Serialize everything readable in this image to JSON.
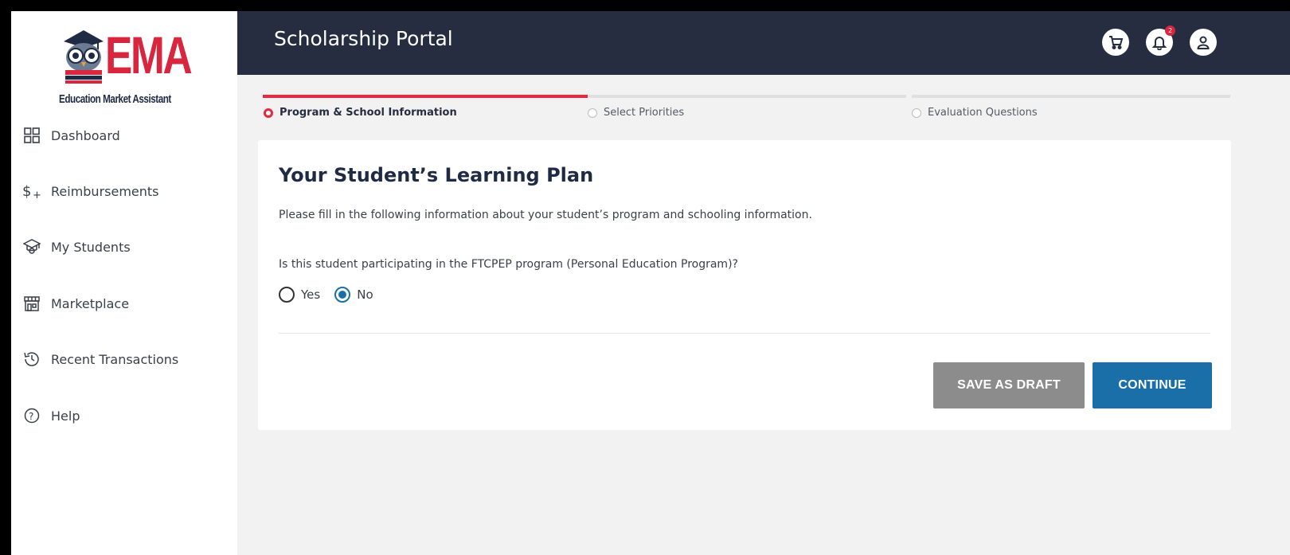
{
  "logo": {
    "brand": "EMA",
    "tagline": "Education Market Assistant",
    "brand_color": "#d7263d"
  },
  "sidebar": {
    "items": [
      {
        "label": "Dashboard",
        "icon": "dashboard-grid-icon"
      },
      {
        "label": "Reimbursements",
        "icon": "dollar-plus-icon"
      },
      {
        "label": "My Students",
        "icon": "graduation-cap-icon"
      },
      {
        "label": "Marketplace",
        "icon": "storefront-icon"
      },
      {
        "label": "Recent Transactions",
        "icon": "history-clock-icon"
      },
      {
        "label": "Help",
        "icon": "help-circle-icon"
      }
    ]
  },
  "header": {
    "title": "Scholarship Portal",
    "background": "#262d40",
    "icons": [
      {
        "name": "cart-icon"
      },
      {
        "name": "notification-bell-icon",
        "badge": "2"
      },
      {
        "name": "user-account-icon"
      }
    ]
  },
  "stepper": {
    "accent": "#e8283e",
    "steps": [
      {
        "label": "Program & School Information",
        "active": true
      },
      {
        "label": "Select Priorities",
        "active": false
      },
      {
        "label": "Evaluation Questions",
        "active": false
      }
    ]
  },
  "form": {
    "title": "Your Student’s Learning Plan",
    "description": "Please fill in the following information about your student’s program and schooling information.",
    "question": "Is this student participating in the FTCPEP program (Personal Education Program)?",
    "options": [
      {
        "label": "Yes",
        "selected": false
      },
      {
        "label": "No",
        "selected": true
      }
    ],
    "buttons": {
      "save_draft": "SAVE AS DRAFT",
      "continue": "CONTINUE"
    },
    "primary_color": "#1a6fa8",
    "secondary_color": "#8c8c8c"
  }
}
